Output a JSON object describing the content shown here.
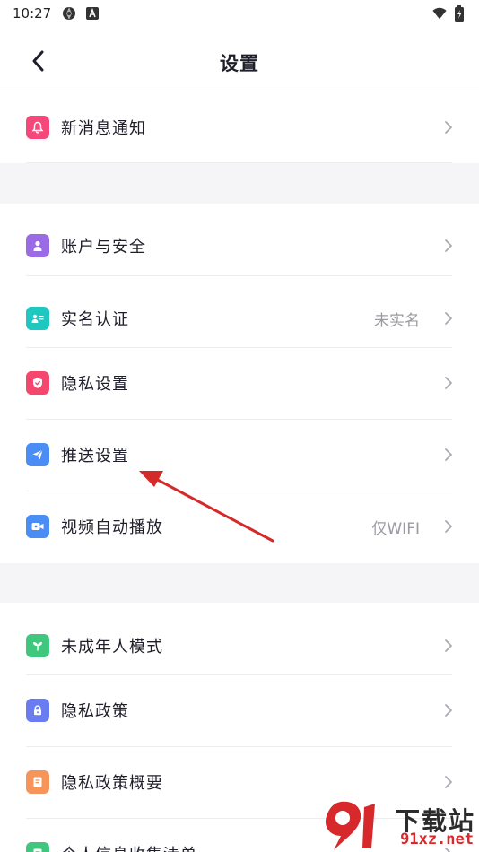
{
  "status_bar": {
    "time": "10:27"
  },
  "header": {
    "title": "设置"
  },
  "sections": [
    {
      "items": [
        {
          "label": "新消息通知",
          "icon": "bell-icon",
          "color": "#f5477a"
        }
      ]
    },
    {
      "items": [
        {
          "label": "账户与安全",
          "icon": "user-icon",
          "color": "#9b6be6"
        },
        {
          "label": "实名认证",
          "value": "未实名",
          "icon": "id-card-icon",
          "color": "#1fc7c1"
        },
        {
          "label": "隐私设置",
          "icon": "shield-icon",
          "color": "#f5476d"
        },
        {
          "label": "推送设置",
          "icon": "send-icon",
          "color": "#4a8df5"
        },
        {
          "label": "视频自动播放",
          "value": "仅WIFI",
          "icon": "video-icon",
          "color": "#4a8df5"
        }
      ]
    },
    {
      "items": [
        {
          "label": "未成年人模式",
          "icon": "sprout-icon",
          "color": "#3fc77e"
        },
        {
          "label": "隐私政策",
          "icon": "lock-icon",
          "color": "#6a7cf2"
        },
        {
          "label": "隐私政策概要",
          "icon": "document-icon",
          "color": "#f7945a"
        },
        {
          "label": "个人信息收集清单",
          "icon": "list-icon",
          "color": "#3fc77e"
        }
      ]
    }
  ],
  "watermark": {
    "brand": "下载站",
    "domain": "91xz.net"
  },
  "colors": {
    "background_gap": "#f5f5f7",
    "text_primary": "#1f1f2b",
    "text_secondary": "#9a9aa3",
    "annotation_arrow": "#d42a2a"
  }
}
